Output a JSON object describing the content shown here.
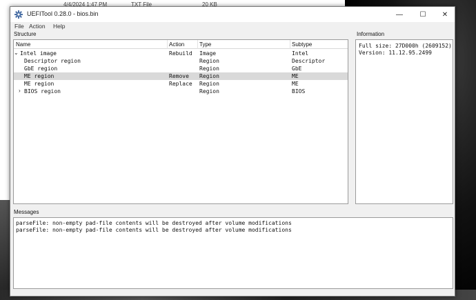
{
  "background": {
    "explorer_row": {
      "date": "4/4/2024 1:47 PM",
      "type": "TXT File",
      "size": "20 KB"
    }
  },
  "window": {
    "title": "UEFITool 0.28.0 - bios.bin",
    "controls": {
      "minimize": "—",
      "maximize": "☐",
      "close": "✕"
    }
  },
  "menu": [
    "File",
    "Action",
    "Help"
  ],
  "structure": {
    "label": "Structure",
    "columns": [
      "Name",
      "Action",
      "Type",
      "Subtype"
    ],
    "rows": [
      {
        "name": "Intel image",
        "action": "Rebuild",
        "type": "Image",
        "subtype": "Intel",
        "expander": "⌄",
        "indent": 0,
        "selected": false
      },
      {
        "name": "Descriptor region",
        "action": "",
        "type": "Region",
        "subtype": "Descriptor",
        "expander": "",
        "indent": 1,
        "selected": false
      },
      {
        "name": "GbE region",
        "action": "",
        "type": "Region",
        "subtype": "GbE",
        "expander": "",
        "indent": 1,
        "selected": false
      },
      {
        "name": "ME region",
        "action": "Remove",
        "type": "Region",
        "subtype": "ME",
        "expander": "",
        "indent": 1,
        "selected": true
      },
      {
        "name": "ME region",
        "action": "Replace",
        "type": "Region",
        "subtype": "ME",
        "expander": "",
        "indent": 1,
        "selected": false
      },
      {
        "name": "BIOS region",
        "action": "",
        "type": "Region",
        "subtype": "BIOS",
        "expander": "›",
        "indent": 1,
        "selected": false
      }
    ]
  },
  "information": {
    "label": "Information",
    "lines": [
      "Full size: 27D000h (2609152)",
      "Version: 11.12.95.2499"
    ]
  },
  "messages": {
    "label": "Messages",
    "lines": [
      "parseFile: non-empty pad-file contents will be destroyed after volume modifications",
      "parseFile: non-empty pad-file contents will be destroyed after volume modifications"
    ]
  },
  "colors": {
    "selection": "#d9d9d9",
    "window_bg": "#f0f0f0",
    "panel_bg": "#ffffff"
  }
}
